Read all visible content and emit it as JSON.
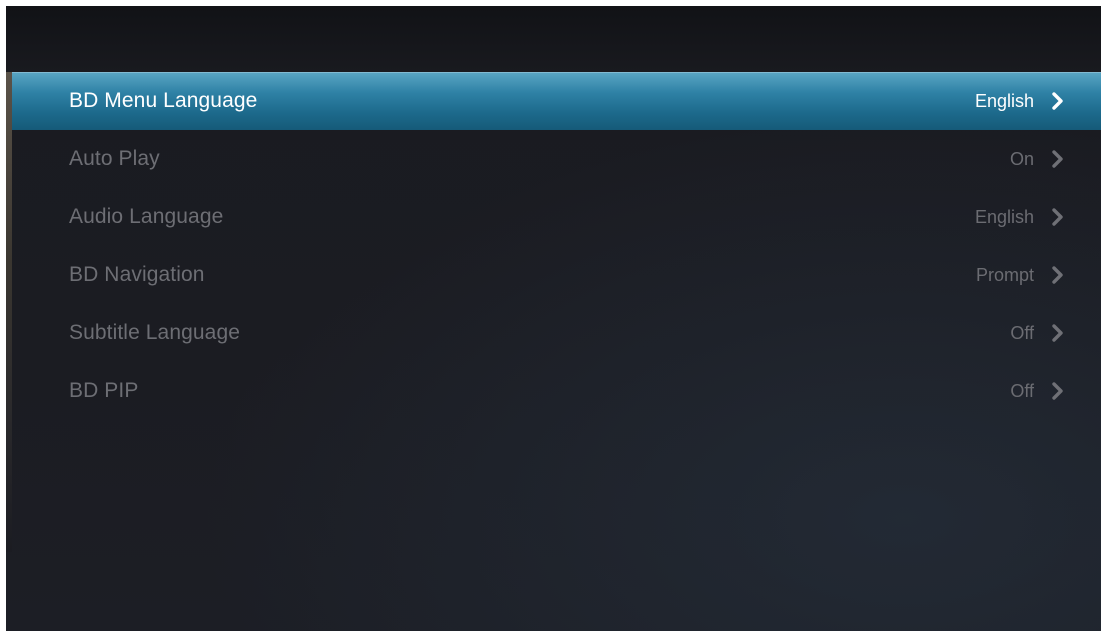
{
  "menu": {
    "items": [
      {
        "label": "BD Menu Language",
        "value": "English",
        "selected": true
      },
      {
        "label": "Auto Play",
        "value": "On",
        "selected": false
      },
      {
        "label": "Audio Language",
        "value": "English",
        "selected": false
      },
      {
        "label": "BD Navigation",
        "value": "Prompt",
        "selected": false
      },
      {
        "label": "Subtitle Language",
        "value": "Off",
        "selected": false
      },
      {
        "label": "BD PIP",
        "value": "Off",
        "selected": false
      }
    ]
  },
  "icons": {
    "row_arrow": "chevron-right-icon"
  },
  "colors": {
    "selected_bar": "#2f82a6",
    "selected_text": "#ffffff",
    "inactive_text": "#6d6e74",
    "background": "#1b1c22"
  }
}
